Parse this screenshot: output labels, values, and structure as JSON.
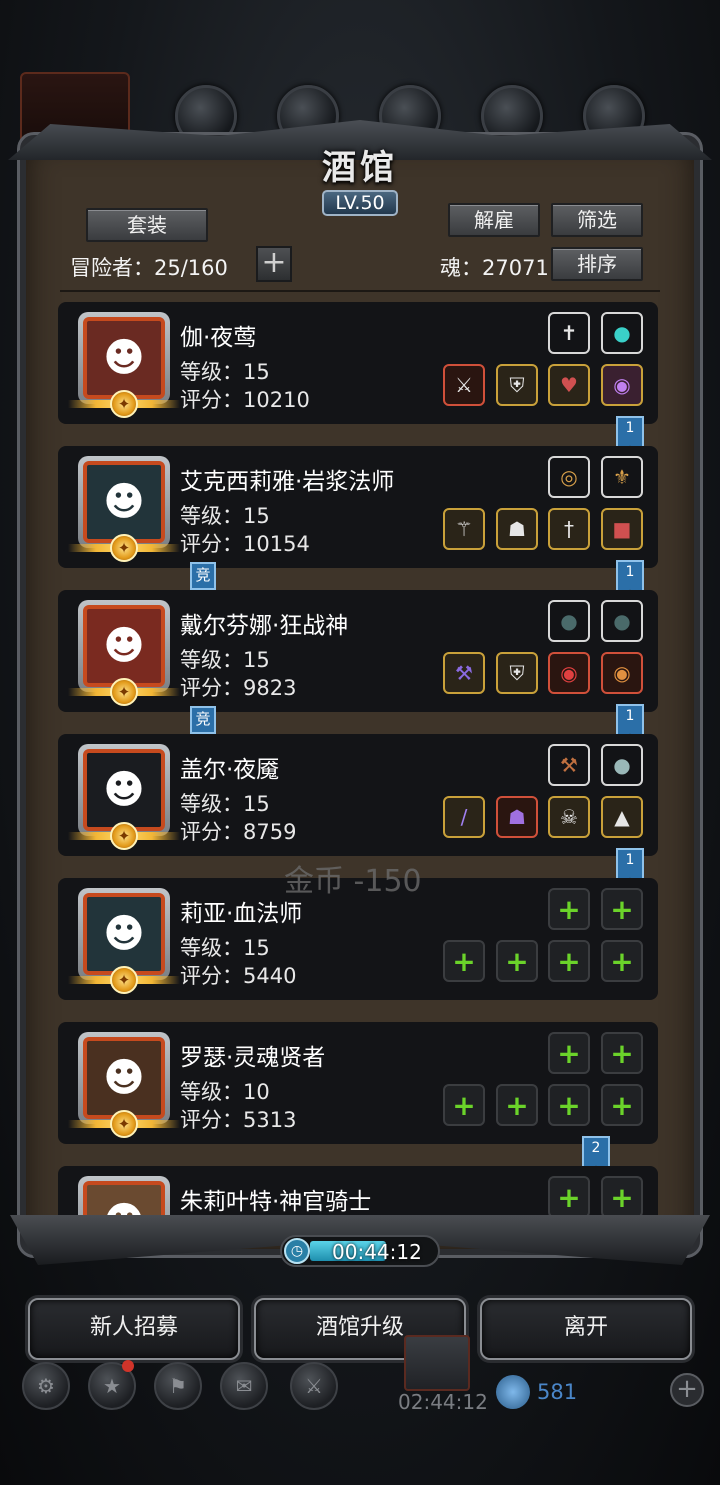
{
  "header": {
    "title": "酒馆",
    "level": "LV.50",
    "set_btn": "套装",
    "dismiss_btn": "解雇",
    "filter_btn": "筛选",
    "sort_btn": "排序",
    "adventurers": "冒险者：25/160",
    "soul": "魂：27071"
  },
  "heroes": [
    {
      "name": "伽·夜莺",
      "level": "等级：15",
      "score": "评分：10210",
      "flag": "1",
      "jing": ""
    },
    {
      "name": "艾克西莉雅·岩浆法师",
      "level": "等级：15",
      "score": "评分：10154",
      "flag": "1",
      "jing": "竞"
    },
    {
      "name": "戴尔芬娜·狂战神",
      "level": "等级：15",
      "score": "评分：9823",
      "flag": "1",
      "jing": "竞"
    },
    {
      "name": "盖尔·夜魇",
      "level": "等级：15",
      "score": "评分：8759",
      "flag": "1",
      "jing": ""
    },
    {
      "name": "莉亚·血法师",
      "level": "等级：15",
      "score": "评分：5440",
      "flag": "",
      "jing": ""
    },
    {
      "name": "罗瑟·灵魂贤者",
      "level": "等级：10",
      "score": "评分：5313",
      "flag": "2",
      "jing": ""
    },
    {
      "name": "朱莉叶特·神官骑士",
      "level": "",
      "score": "",
      "flag": "",
      "jing": ""
    }
  ],
  "float_text": "金币 -150",
  "timer": {
    "value": "00:44:12",
    "progress": 0.6
  },
  "bottom_buttons": {
    "recruit": "新人招募",
    "upgrade": "酒馆升级",
    "leave": "离开"
  },
  "bottom_bar": {
    "time": "02:44:12",
    "gems": "581"
  },
  "colors": {
    "panel": "#3e3429",
    "card": "#131417",
    "accent_blue": "#2b6fa8",
    "plus_green": "#6bd32a"
  }
}
